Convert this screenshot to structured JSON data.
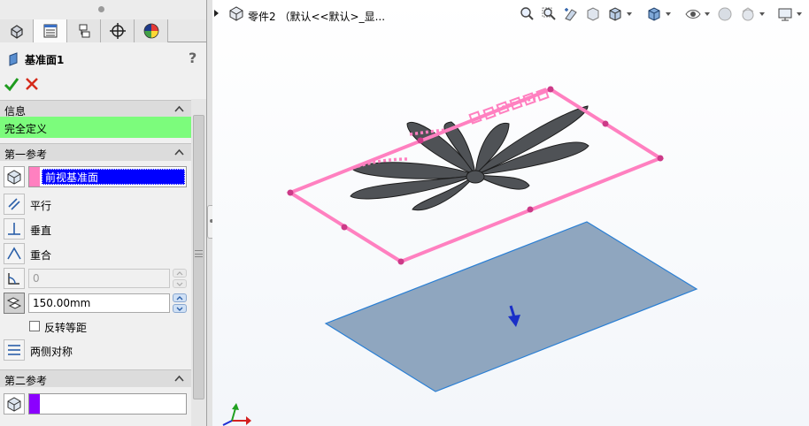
{
  "panel": {
    "tabs": [
      "feature-manager-icon",
      "property-manager-icon",
      "configuration-manager-icon",
      "dimxpert-icon",
      "display-manager-icon"
    ],
    "feature_title": "基准面1",
    "help_label": "?",
    "ok_icon": "checkmark-icon",
    "cancel_icon": "x-icon"
  },
  "message": {
    "header": "信息",
    "status": "完全定义",
    "status_color": "#7cfc7c"
  },
  "first_reference": {
    "header": "第一参考",
    "selection": "前视基准面",
    "selection_color": "#ff80c0",
    "options": {
      "parallel": "平行",
      "perpendicular": "垂直",
      "coincident": "重合"
    },
    "angle_value": "0",
    "distance_value": "150.00mm",
    "flip_offset_label": "反转等距",
    "flip_offset_checked": false,
    "mid_plane_label": "两侧对称"
  },
  "second_reference": {
    "header": "第二参考",
    "selection": "",
    "selection_color": "#8b00ff"
  },
  "viewport": {
    "document_title": "零件2 （默认<<默认>_显...",
    "heads_up_icons": [
      "zoom-to-fit-icon",
      "zoom-to-area-icon",
      "previous-view-icon",
      "section-view-icon",
      "view-orientation-icon",
      "display-style-icon",
      "hide-show-items-icon",
      "edit-appearance-icon",
      "apply-scene-icon",
      "view-settings-icon"
    ],
    "preview_plane_color": "#ff80c0",
    "base_plane_color": "#8fa6bf",
    "model_color": "#4f5256"
  }
}
